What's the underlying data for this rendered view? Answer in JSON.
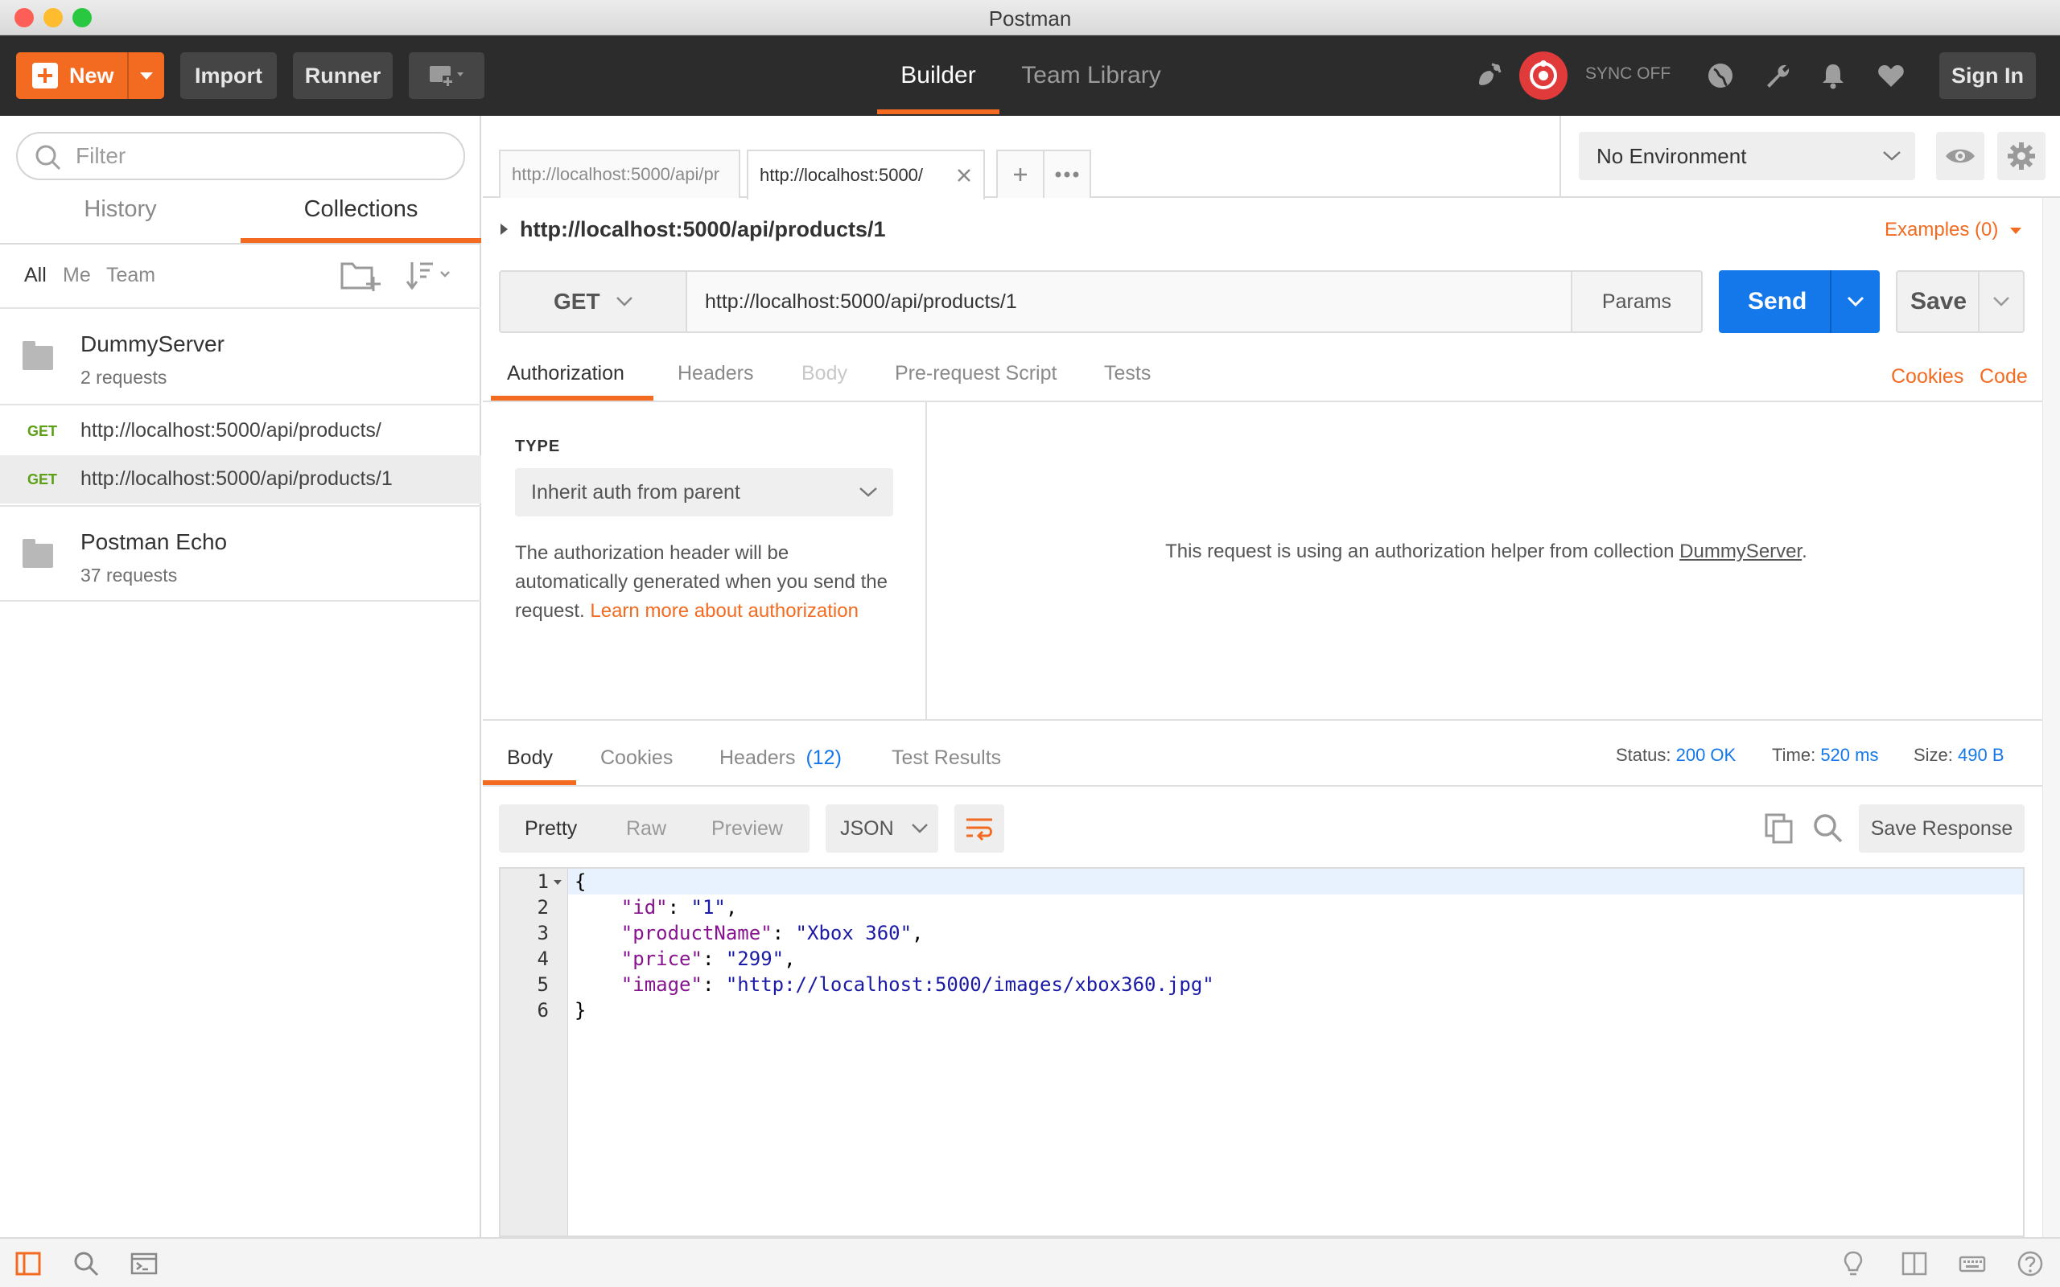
{
  "window": {
    "title": "Postman"
  },
  "header": {
    "new_label": "New",
    "import_label": "Import",
    "runner_label": "Runner",
    "tabs": [
      "Builder",
      "Team Library"
    ],
    "sync_label": "SYNC OFF",
    "signin_label": "Sign In"
  },
  "sidebar": {
    "filter_placeholder": "Filter",
    "tabs": [
      "History",
      "Collections"
    ],
    "filters": [
      "All",
      "Me",
      "Team"
    ],
    "collections": [
      {
        "name": "DummyServer",
        "count": "2 requests"
      },
      {
        "name": "Postman Echo",
        "count": "37 requests"
      }
    ],
    "requests": [
      {
        "method": "GET",
        "url": "http://localhost:5000/api/products/"
      },
      {
        "method": "GET",
        "url": "http://localhost:5000/api/products/1"
      }
    ]
  },
  "request_tabs": [
    {
      "label": "http://localhost:5000/api/pr"
    },
    {
      "label": "http://localhost:5000/"
    }
  ],
  "environment": {
    "selected": "No Environment"
  },
  "request": {
    "title": "http://localhost:5000/api/products/1",
    "examples_label": "Examples (0)",
    "method": "GET",
    "url": "http://localhost:5000/api/products/1",
    "params_label": "Params",
    "send_label": "Send",
    "save_label": "Save",
    "tabs": [
      "Authorization",
      "Headers",
      "Body",
      "Pre-request Script",
      "Tests"
    ],
    "links": [
      "Cookies",
      "Code"
    ]
  },
  "auth": {
    "type_label": "TYPE",
    "type_value": "Inherit auth from parent",
    "desc_text": "The authorization header will be automatically generated when you send the request. ",
    "desc_link": "Learn more about authorization",
    "helper_text": "This request is using an authorization helper from collection ",
    "helper_link": "DummyServer",
    "helper_end": "."
  },
  "response": {
    "tabs": [
      "Body",
      "Cookies",
      "Headers",
      "Test Results"
    ],
    "headers_count": "(12)",
    "status_label": "Status:",
    "status_value": "200 OK",
    "time_label": "Time:",
    "time_value": "520 ms",
    "size_label": "Size:",
    "size_value": "490 B",
    "view_options": [
      "Pretty",
      "Raw",
      "Preview"
    ],
    "format": "JSON",
    "save_response_label": "Save Response",
    "line_numbers": [
      "1",
      "2",
      "3",
      "4",
      "5",
      "6"
    ],
    "code": {
      "open": "{",
      "id_key": "\"id\"",
      "id_val": "\"1\"",
      "name_key": "\"productName\"",
      "name_val": "\"Xbox 360\"",
      "price_key": "\"price\"",
      "price_val": "\"299\"",
      "image_key": "\"image\"",
      "image_val": "\"http://localhost:5000/images/xbox360.jpg\"",
      "close": "}"
    }
  },
  "colors": {
    "accent": "#f26b21",
    "primary": "#1477ea",
    "get_method": "#5ca016"
  }
}
